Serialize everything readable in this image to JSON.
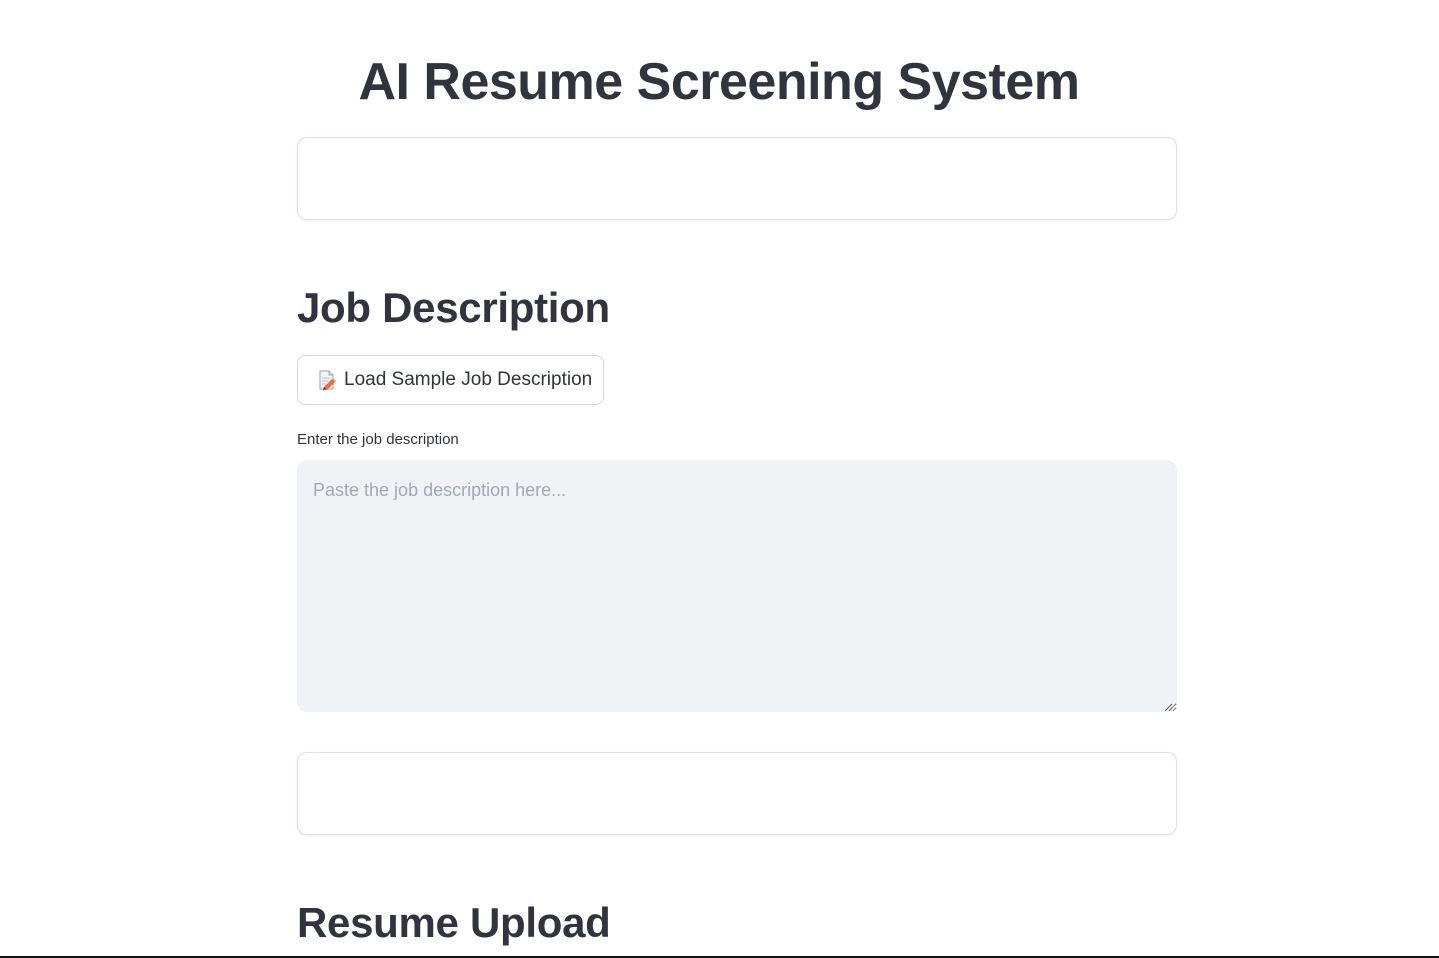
{
  "header": {
    "title": "AI Resume Screening System"
  },
  "job_description": {
    "heading": "Job Description",
    "load_sample_button": {
      "icon": "memo-icon",
      "label": "Load Sample Job Description"
    },
    "field_label": "Enter the job description",
    "textarea": {
      "value": "",
      "placeholder": "Paste the job description here..."
    }
  },
  "resume_upload": {
    "heading": "Resume Upload"
  },
  "colors": {
    "text": "#31333f",
    "textarea_bg": "#f0f2f6",
    "placeholder": "#a3a8b4",
    "border": "#e0e2e8"
  }
}
